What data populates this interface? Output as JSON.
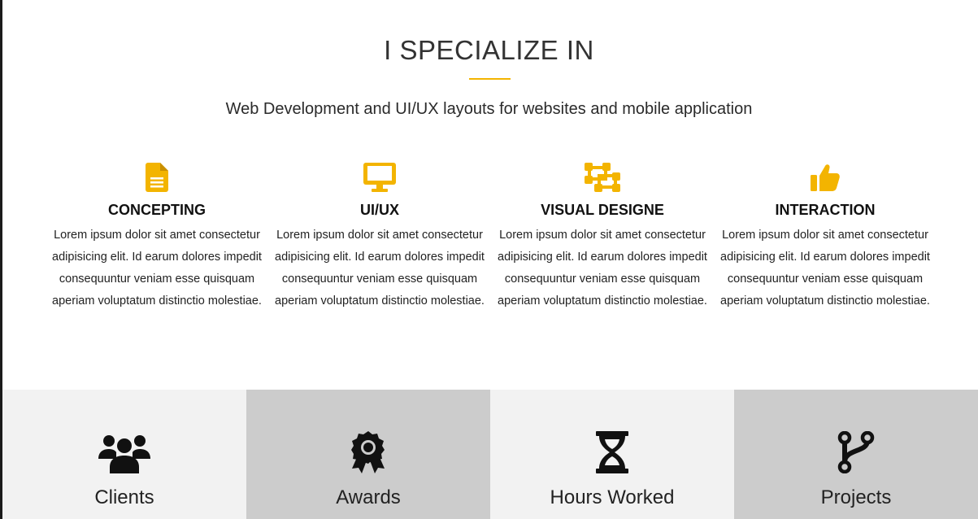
{
  "header": {
    "title": "I SPECIALIZE IN",
    "subtitle": "Web Development and UI/UX layouts for websites and mobile application"
  },
  "services": [
    {
      "icon": "file-icon",
      "title": "CONCEPTING",
      "text": "Lorem ipsum dolor sit amet consectetur adipisicing elit. Id earum dolores impedit consequuntur veniam esse quisquam aperiam voluptatum distinctio molestiae."
    },
    {
      "icon": "desktop-icon",
      "title": "UI/UX",
      "text": "Lorem ipsum dolor sit amet consectetur adipisicing elit. Id earum dolores impedit consequuntur veniam esse quisquam aperiam voluptatum distinctio molestiae."
    },
    {
      "icon": "object-group-icon",
      "title": "VISUAL DESIGNE",
      "text": "Lorem ipsum dolor sit amet consectetur adipisicing elit. Id earum dolores impedit consequuntur veniam esse quisquam aperiam voluptatum distinctio molestiae."
    },
    {
      "icon": "thumbs-up-icon",
      "title": "INTERACTION",
      "text": "Lorem ipsum dolor sit amet consectetur adipisicing elit. Id earum dolores impedit consequuntur veniam esse quisquam aperiam voluptatum distinctio molestiae."
    }
  ],
  "stats": [
    {
      "icon": "users-icon",
      "label": "Clients"
    },
    {
      "icon": "award-icon",
      "label": "Awards"
    },
    {
      "icon": "hourglass-icon",
      "label": "Hours Worked"
    },
    {
      "icon": "code-branch-icon",
      "label": "Projects"
    }
  ],
  "colors": {
    "accent": "#f3b400",
    "stat_light": "#f2f2f2",
    "stat_dark": "#cccccc"
  }
}
